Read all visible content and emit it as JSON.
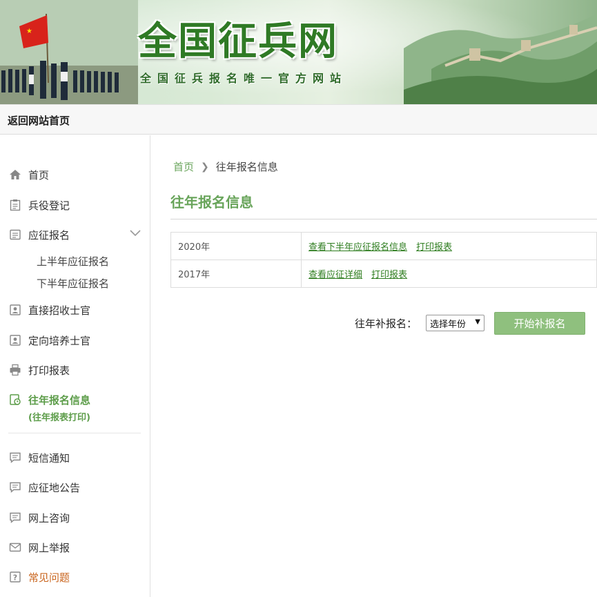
{
  "header": {
    "site_title": "全国征兵网",
    "site_subtitle": "全国征兵报名唯一官方网站"
  },
  "topbar": {
    "back_home": "返回网站首页"
  },
  "sidebar": {
    "items": [
      {
        "label": "首页",
        "icon": "home-icon"
      },
      {
        "label": "兵役登记",
        "icon": "clipboard-icon"
      },
      {
        "label": "应征报名",
        "icon": "form-icon"
      },
      {
        "label": "直接招收士官",
        "icon": "person-card-icon"
      },
      {
        "label": "定向培养士官",
        "icon": "person-card-icon"
      },
      {
        "label": "打印报表",
        "icon": "printer-icon"
      },
      {
        "label": "往年报名信息",
        "icon": "history-doc-icon"
      },
      {
        "label": "短信通知",
        "icon": "message-icon"
      },
      {
        "label": "应征地公告",
        "icon": "message-icon"
      },
      {
        "label": "网上咨询",
        "icon": "message-icon"
      },
      {
        "label": "网上举报",
        "icon": "mail-icon"
      },
      {
        "label": "常见问题",
        "icon": "help-icon"
      }
    ],
    "sub_items": [
      "上半年应征报名",
      "下半年应征报名"
    ],
    "active_sub_label": "(往年报表打印)"
  },
  "breadcrumb": {
    "home": "首页",
    "current": "往年报名信息"
  },
  "main": {
    "title": "往年报名信息",
    "records": [
      {
        "year": "2020年",
        "links": [
          "查看下半年应征报名信息",
          "打印报表"
        ]
      },
      {
        "year": "2017年",
        "links": [
          "查看应征详细",
          "打印报表"
        ]
      }
    ],
    "makeup": {
      "label": "往年补报名：",
      "select_value": "选择年份",
      "button": "开始补报名"
    }
  },
  "colors": {
    "accent_green": "#68a45a",
    "link_green": "#2e7d1f",
    "button_green": "#8fc07e",
    "faq_orange": "#c9641d"
  }
}
